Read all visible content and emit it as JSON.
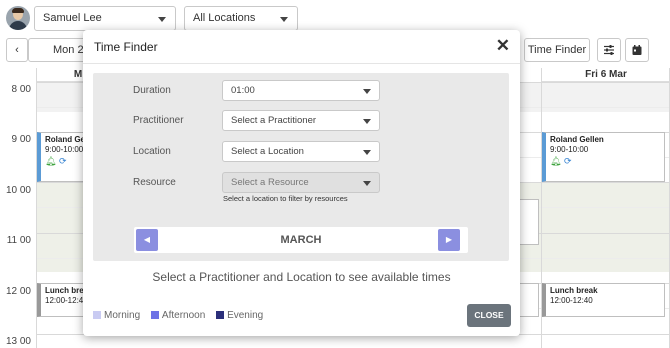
{
  "topbar": {
    "user": "Samuel Lee",
    "location": "All Locations"
  },
  "toolbar": {
    "prev_label": "‹",
    "date_label": "Mon 2/",
    "time_finder_label": "Time Finder",
    "filter_icon": "sliders-icon",
    "calendar_icon": "calendar-icon"
  },
  "calendar": {
    "day_headers": {
      "first": "M",
      "last": "Fri 6 Mar"
    },
    "hours": [
      "8 00",
      "9 00",
      "10 00",
      "11 00",
      "12 00",
      "13 00"
    ],
    "appointments": {
      "mon_roland": {
        "title": "Roland Gel",
        "time": "9:00-10:00"
      },
      "fri_roland": {
        "title": "Roland Gellen",
        "time": "9:00-10:00"
      },
      "mon_lunch": {
        "title": "Lunch bre",
        "time": "12:00-12:4"
      },
      "fri_lunch": {
        "title": "Lunch break",
        "time": "12:00-12:40"
      }
    }
  },
  "modal": {
    "title": "Time Finder",
    "close_glyph": "✕",
    "fields": {
      "duration": {
        "label": "Duration",
        "value": "01:00"
      },
      "practitioner": {
        "label": "Practitioner",
        "placeholder": "Select a Practitioner"
      },
      "location": {
        "label": "Location",
        "placeholder": "Select a Location"
      },
      "resource": {
        "label": "Resource",
        "placeholder": "Select a Resource"
      }
    },
    "resource_hint": "Select a location to filter by resources",
    "month": "MARCH",
    "month_prev": "◀",
    "month_next": "▶",
    "instruction": "Select a Practitioner and Location to see available times",
    "legend": [
      {
        "label": "Morning",
        "color": "#c9cbf2"
      },
      {
        "label": "Afternoon",
        "color": "#6e73e6"
      },
      {
        "label": "Evening",
        "color": "#2b2f7a"
      }
    ],
    "close_button": "CLOSE"
  },
  "colors": {
    "accent": "#8b8fe0",
    "appointment_border": "#5b9bd5",
    "close_button": "#6b747c"
  }
}
